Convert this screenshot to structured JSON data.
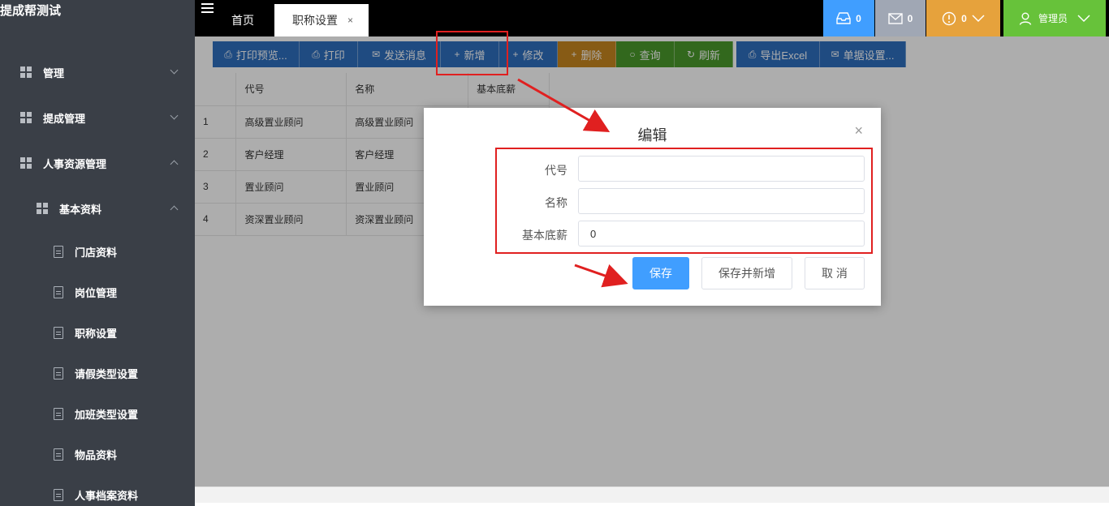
{
  "app": {
    "title": "提成帮测试"
  },
  "sidebar": {
    "groups": [
      {
        "label": "管理",
        "expanded": false
      },
      {
        "label": "提成管理",
        "expanded": false
      },
      {
        "label": "人事资源管理",
        "expanded": true
      }
    ],
    "subgroup": {
      "label": "基本资料",
      "expanded": true
    },
    "items": [
      {
        "label": "门店资料"
      },
      {
        "label": "岗位管理"
      },
      {
        "label": "职称设置"
      },
      {
        "label": "请假类型设置"
      },
      {
        "label": "加班类型设置"
      },
      {
        "label": "物品资料"
      },
      {
        "label": "人事档案资料"
      }
    ]
  },
  "topbar": {
    "tabs": {
      "home": "首页",
      "active": "职称设置",
      "close": "×"
    },
    "inbox": {
      "count": "0",
      "color": "#409eff",
      "icon": "inbox-icon"
    },
    "mail": {
      "count": "0",
      "color": "#a0a7b4",
      "icon": "mail-icon"
    },
    "alert": {
      "count": "0",
      "color": "#e6a23c",
      "icon": "alert-icon"
    },
    "user": {
      "label": "管理员",
      "color": "#67c23a",
      "icon": "user-icon"
    }
  },
  "toolbar": {
    "buttons": [
      {
        "label": "打印预览...",
        "icon": "🖨",
        "color": "#2f6fbf"
      },
      {
        "label": "打印",
        "icon": "🖨",
        "color": "#2f6fbf"
      },
      {
        "label": "发送消息",
        "icon": "✉",
        "color": "#2f6fbf"
      },
      {
        "label": "新增",
        "icon": "+",
        "color": "#2f6fbf"
      },
      {
        "label": "修改",
        "icon": "+",
        "color": "#2f6fbf"
      },
      {
        "label": "删除",
        "icon": "+",
        "color": "#c8861f"
      },
      {
        "label": "查询",
        "icon": "○",
        "color": "#4a9a2c"
      },
      {
        "label": "刷新",
        "icon": "↻",
        "color": "#4a9a2c"
      },
      {
        "label": "导出Excel",
        "icon": "🖨",
        "color": "#2f6fbf"
      },
      {
        "label": "单据设置...",
        "icon": "✉",
        "color": "#2f6fbf"
      }
    ]
  },
  "table": {
    "headers": [
      "",
      "代号",
      "名称",
      "基本底薪"
    ],
    "rows": [
      [
        "1",
        "高级置业顾问",
        "高级置业顾问",
        ""
      ],
      [
        "2",
        "客户经理",
        "客户经理",
        ""
      ],
      [
        "3",
        "置业顾问",
        "置业顾问",
        ""
      ],
      [
        "4",
        "资深置业顾问",
        "资深置业顾问",
        ""
      ]
    ]
  },
  "modal": {
    "title": "编辑",
    "close": "×",
    "fields": {
      "code": {
        "label": "代号",
        "value": ""
      },
      "name": {
        "label": "名称",
        "value": ""
      },
      "salary": {
        "label": "基本底薪",
        "value": "0"
      }
    },
    "buttons": {
      "save": "保存",
      "save_new": "保存并新增",
      "cancel": "取 消"
    }
  }
}
